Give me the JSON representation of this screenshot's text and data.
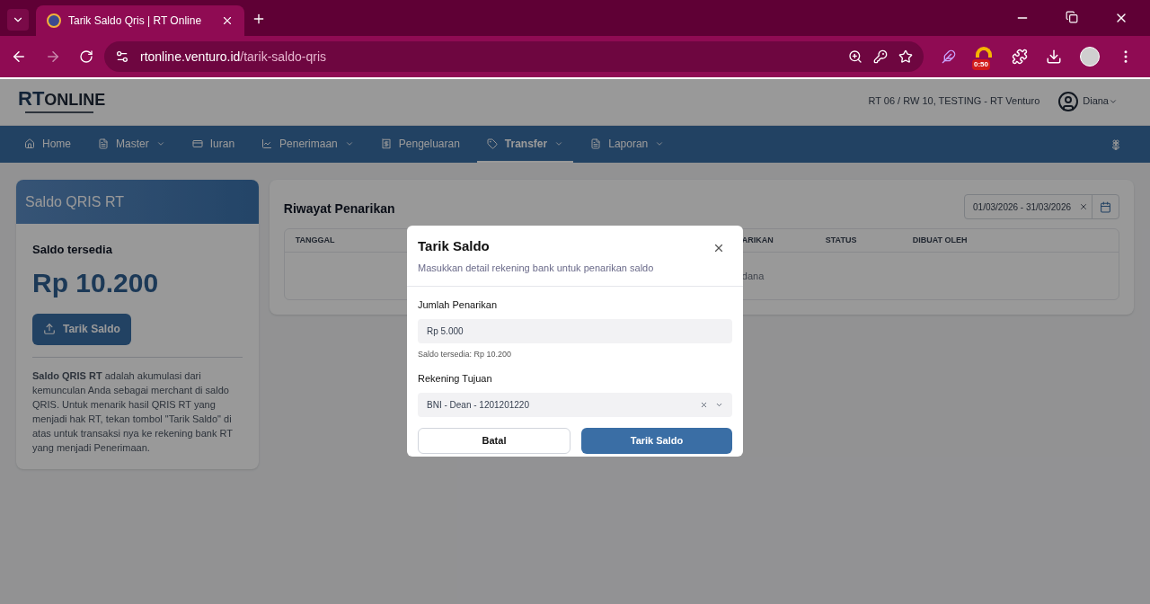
{
  "browser": {
    "tab_title": "Tarik Saldo Qris | RT Online",
    "url_host": "rtonline.venturo.id",
    "url_path": "/tarik-saldo-qris",
    "extension_badge": "0:50"
  },
  "header": {
    "logo_main": "RT",
    "logo_rest": "ONLINE",
    "org": "RT 06 / RW 10, TESTING - RT Venturo",
    "user": "Diana"
  },
  "nav": [
    {
      "label": "Home",
      "dropdown": false,
      "selected": false
    },
    {
      "label": "Master",
      "dropdown": true,
      "selected": false
    },
    {
      "label": "Iuran",
      "dropdown": false,
      "selected": false
    },
    {
      "label": "Penerimaan",
      "dropdown": true,
      "selected": false
    },
    {
      "label": "Pengeluaran",
      "dropdown": false,
      "selected": false
    },
    {
      "label": "Transfer",
      "dropdown": true,
      "selected": true
    },
    {
      "label": "Laporan",
      "dropdown": true,
      "selected": false
    }
  ],
  "saldo_card": {
    "title": "Saldo QRIS RT",
    "label": "Saldo tersedia",
    "amount": "Rp 10.200",
    "button": "Tarik Saldo",
    "description": "**Saldo QRIS RT** adalah akumulasi dari kemunculan Anda sebagai merchant di saldo QRIS. Untuk menarik hasil QRIS RT yang menjadi hak RT, tekan tombol \"Tarik Saldo\" di atas untuk transaksi nya ke rekening bank RT yang menjadi Penerimaan."
  },
  "history": {
    "title": "Riwayat Penarikan",
    "date_range": "01/03/2026 - 31/03/2026",
    "columns": [
      "TANGGAL",
      "ARIKAN",
      "STATUS",
      "DIBUAT OLEH"
    ],
    "empty_text": "dana"
  },
  "dialog": {
    "title": "Tarik Saldo",
    "subtitle": "Masukkan detail rekening bank untuk penarikan saldo",
    "amount_label": "Jumlah Penarikan",
    "amount_value": "Rp 5.000",
    "amount_hint": "Saldo tersedia: Rp 10.200",
    "account_label": "Rekening Tujuan",
    "account_value": "BNI - Dean - 1201201220",
    "cancel": "Batal",
    "submit": "Tarik Saldo"
  }
}
